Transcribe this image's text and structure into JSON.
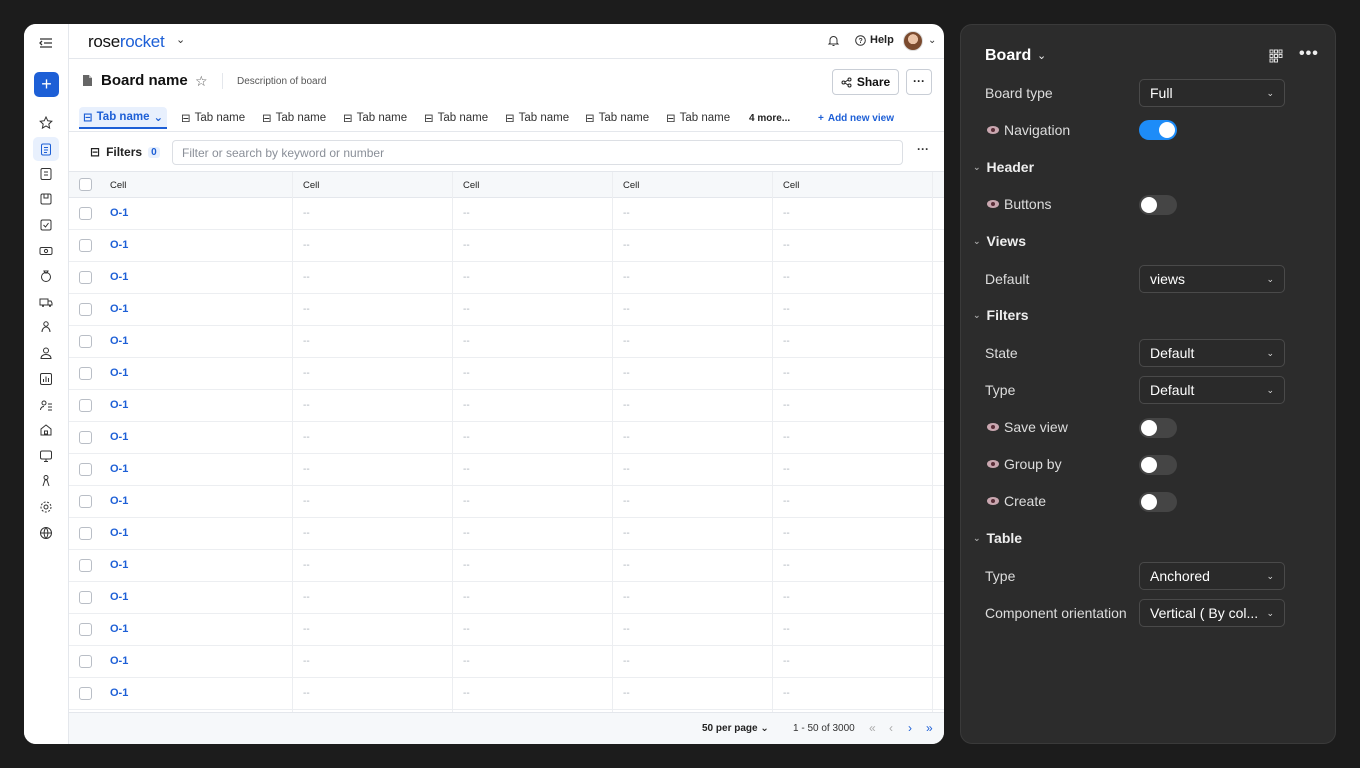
{
  "app": {
    "logo_prefix": "rose",
    "logo_suffix": "rocket",
    "help_label": "Help",
    "board_title": "Board name",
    "description": "Description of board",
    "share_label": "Share",
    "more_label": "···"
  },
  "tabs": [
    {
      "label": "Tab name",
      "active": true
    },
    {
      "label": "Tab name"
    },
    {
      "label": "Tab name"
    },
    {
      "label": "Tab name"
    },
    {
      "label": "Tab name"
    },
    {
      "label": "Tab name"
    },
    {
      "label": "Tab name"
    },
    {
      "label": "Tab name"
    }
  ],
  "tabs_more": "4 more...",
  "tabs_add": "Add new view",
  "filters": {
    "label": "Filters",
    "count": "0",
    "search_placeholder": "Filter or search by keyword or number",
    "more_label": "···"
  },
  "table": {
    "headers": [
      "Cell",
      "Cell",
      "Cell",
      "Cell",
      "Cell"
    ],
    "rows": [
      [
        "O-1",
        "--",
        "--",
        "--",
        "--"
      ],
      [
        "O-1",
        "--",
        "--",
        "--",
        "--"
      ],
      [
        "O-1",
        "--",
        "--",
        "--",
        "--"
      ],
      [
        "O-1",
        "--",
        "--",
        "--",
        "--"
      ],
      [
        "O-1",
        "--",
        "--",
        "--",
        "--"
      ],
      [
        "O-1",
        "--",
        "--",
        "--",
        "--"
      ],
      [
        "O-1",
        "--",
        "--",
        "--",
        "--"
      ],
      [
        "O-1",
        "--",
        "--",
        "--",
        "--"
      ],
      [
        "O-1",
        "--",
        "--",
        "--",
        "--"
      ],
      [
        "O-1",
        "--",
        "--",
        "--",
        "--"
      ],
      [
        "O-1",
        "--",
        "--",
        "--",
        "--"
      ],
      [
        "O-1",
        "--",
        "--",
        "--",
        "--"
      ],
      [
        "O-1",
        "--",
        "--",
        "--",
        "--"
      ],
      [
        "O-1",
        "--",
        "--",
        "--",
        "--"
      ],
      [
        "O-1",
        "--",
        "--",
        "--",
        "--"
      ],
      [
        "O-1",
        "--",
        "--",
        "--",
        "--"
      ]
    ]
  },
  "pagination": {
    "per_page": "50 per page",
    "range": "1 - 50 of 3000"
  },
  "panel": {
    "title": "Board",
    "board_type_label": "Board type",
    "board_type_value": "Full",
    "navigation_label": "Navigation",
    "navigation_on": true,
    "header_section": "Header",
    "buttons_label": "Buttons",
    "buttons_on": false,
    "views_section": "Views",
    "default_label": "Default",
    "default_value": "views",
    "filters_section": "Filters",
    "state_label": "State",
    "state_value": "Default",
    "type_label": "Type",
    "type_value": "Default",
    "save_view_label": "Save view",
    "save_view_on": false,
    "group_by_label": "Group by",
    "group_by_on": false,
    "create_label": "Create",
    "create_on": false,
    "table_section": "Table",
    "table_type_label": "Type",
    "table_type_value": "Anchored",
    "orientation_label": "Component orientation",
    "orientation_value": "Vertical ( By col..."
  },
  "colors": {
    "accent": "#1d5fd6",
    "toggle_on": "#1d8cf8",
    "panel_bg": "#2c2c2c"
  }
}
